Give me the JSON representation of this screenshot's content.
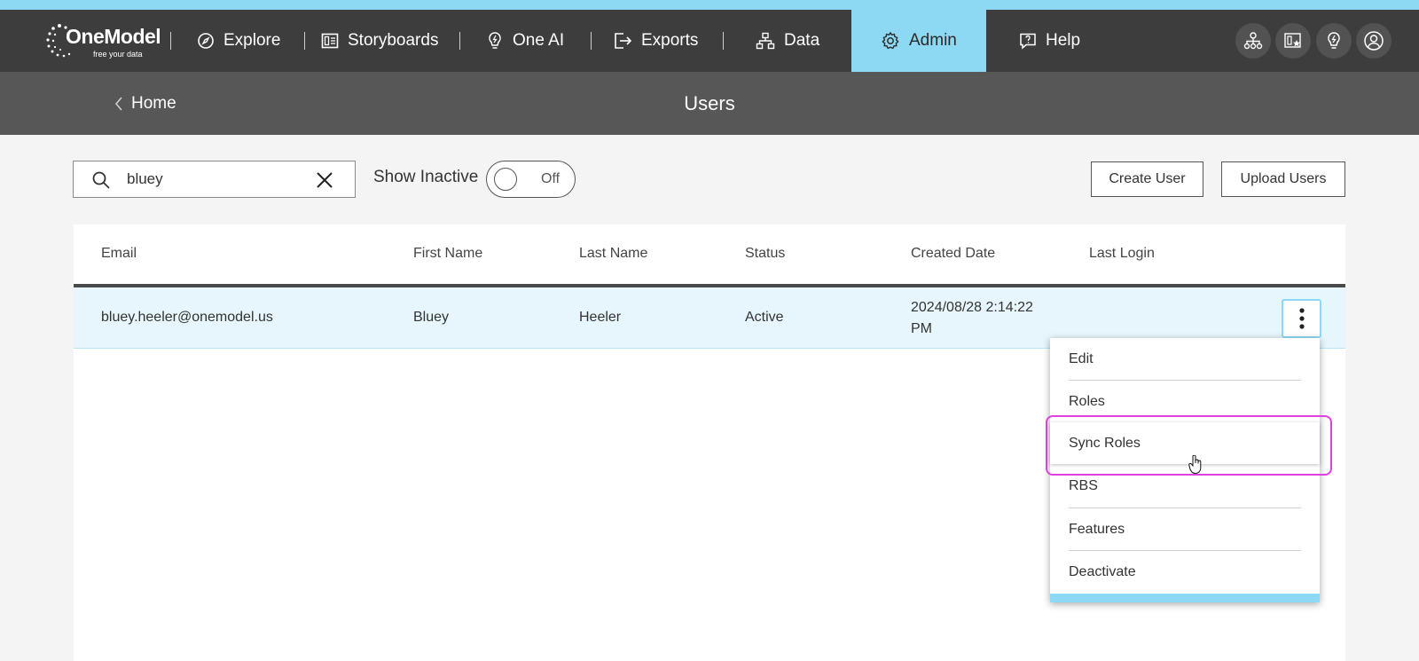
{
  "brand": {
    "name": "OneModel",
    "tagline": "free your data"
  },
  "nav": {
    "items": [
      {
        "label": "Explore",
        "icon": "compass-icon"
      },
      {
        "label": "Storyboards",
        "icon": "storyboard-icon"
      },
      {
        "label": "One AI",
        "icon": "lightbulb-icon"
      },
      {
        "label": "Exports",
        "icon": "export-icon"
      },
      {
        "label": "Data",
        "icon": "hierarchy-icon"
      },
      {
        "label": "Admin",
        "icon": "gear-icon",
        "active": true
      },
      {
        "label": "Help",
        "icon": "help-icon"
      }
    ],
    "right_icons": [
      "org-chart-icon",
      "starred-storyboard-icon",
      "lightbulb-icon",
      "user-profile-icon"
    ]
  },
  "subheader": {
    "back_label": "Home",
    "title": "Users"
  },
  "toolbar": {
    "search_value": "bluey",
    "show_inactive_label": "Show Inactive",
    "toggle_state": "Off",
    "create_user_label": "Create User",
    "upload_users_label": "Upload Users"
  },
  "table": {
    "columns": [
      "Email",
      "First Name",
      "Last Name",
      "Status",
      "Created Date",
      "Last Login"
    ],
    "rows": [
      {
        "email": "bluey.heeler@onemodel.us",
        "first_name": "Bluey",
        "last_name": "Heeler",
        "status": "Active",
        "created_date_line1": "2024/08/28 2:14:22",
        "created_date_line2": "PM",
        "last_login": ""
      }
    ]
  },
  "row_menu": {
    "items": [
      "Edit",
      "Roles",
      "Sync Roles",
      "RBS",
      "Features",
      "Deactivate"
    ],
    "highlighted": "Sync Roles"
  },
  "colors": {
    "accent": "#8dd8f2",
    "nav_bg": "#3d3d3d",
    "subbar_bg": "#575757",
    "row_selected": "#e6f6fc",
    "highlight_ring": "#e040e0"
  }
}
